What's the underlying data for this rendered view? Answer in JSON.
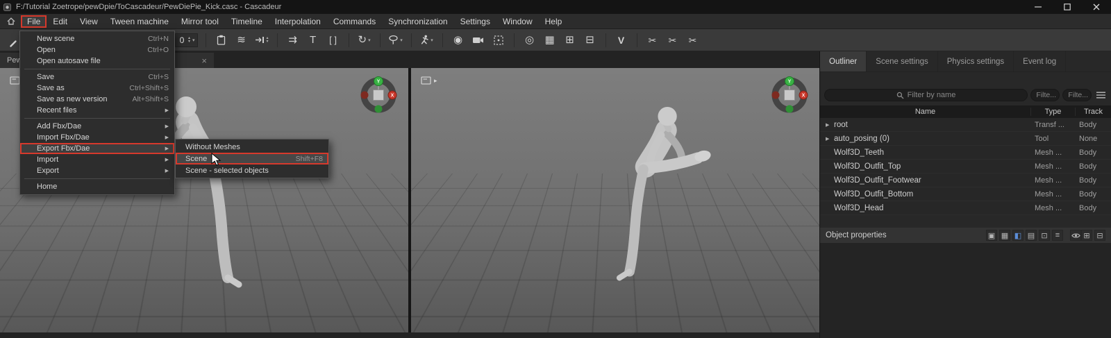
{
  "window": {
    "title": "F:/Tutorial Zoetrope/pewDpie/ToCascadeur/PewDiePie_Kick.casc - Cascadeur"
  },
  "icons": {
    "submenu_arrow": "▶",
    "expander": "▶",
    "vp_arrow": "▸",
    "close": "×",
    "dropdown": "▾",
    "spin_up": "▴",
    "spin_down": "▾",
    "text_tool": "T",
    "brackets": "[ ]",
    "loop": "↻",
    "double_arrows": "⇉",
    "sphere": "◉",
    "rings": "◎",
    "checker": "▦",
    "waves": "≋",
    "win_add_1": "⊞",
    "win_add_2": "⊟",
    "v_tool": "V",
    "scissors": "✂"
  },
  "menubar": {
    "items": [
      {
        "label": "File",
        "boxed": true
      },
      {
        "label": "Edit"
      },
      {
        "label": "View"
      },
      {
        "label": "Tween machine"
      },
      {
        "label": "Mirror tool"
      },
      {
        "label": "Timeline"
      },
      {
        "label": "Interpolation"
      },
      {
        "label": "Commands"
      },
      {
        "label": "Synchronization"
      },
      {
        "label": "Settings"
      },
      {
        "label": "Window"
      },
      {
        "label": "Help"
      }
    ]
  },
  "toolbar": {
    "frame_value": "0"
  },
  "file_menu": {
    "items": [
      {
        "label": "New scene",
        "shortcut": "Ctrl+N"
      },
      {
        "label": "Open",
        "shortcut": "Ctrl+O"
      },
      {
        "label": "Open autosave file"
      },
      {
        "separator": true
      },
      {
        "label": "Save",
        "shortcut": "Ctrl+S"
      },
      {
        "label": "Save as",
        "shortcut": "Ctrl+Shift+S"
      },
      {
        "label": "Save as new version",
        "shortcut": "Alt+Shift+S"
      },
      {
        "label": "Recent files",
        "submenu": true
      },
      {
        "separator": true
      },
      {
        "label": "Add Fbx/Dae",
        "submenu": true
      },
      {
        "label": "Import Fbx/Dae",
        "submenu": true
      },
      {
        "label": "Export Fbx/Dae",
        "submenu": true,
        "highlighted": true
      },
      {
        "label": "Import",
        "submenu": true
      },
      {
        "label": "Export",
        "submenu": true
      },
      {
        "separator": true
      },
      {
        "label": "Home"
      }
    ]
  },
  "export_submenu": {
    "items": [
      {
        "label": "Without Meshes"
      },
      {
        "label": "Scene",
        "shortcut": "Shift+F8",
        "highlighted": true
      },
      {
        "label": "Scene - selected objects"
      }
    ]
  },
  "doc_tab": {
    "label": "Pew"
  },
  "gizmo": {
    "up": "Y",
    "right": "X",
    "up_color": "#3cb54a",
    "right_color": "#c8372a"
  },
  "outliner": {
    "tabs": [
      {
        "label": "Outliner",
        "active": true
      },
      {
        "label": "Scene settings"
      },
      {
        "label": "Physics settings"
      },
      {
        "label": "Event log"
      }
    ],
    "filter_placeholder": "Filter by name",
    "small_filter_placeholder": "Filte...",
    "columns": [
      "Name",
      "Type",
      "Track"
    ],
    "rows": [
      {
        "name": "root",
        "type": "Transf ...",
        "track": "Body",
        "expandable": true
      },
      {
        "name": "auto_posing (0)",
        "type": "Tool",
        "track": "None",
        "expandable": true
      },
      {
        "name": "Wolf3D_Teeth",
        "type": "Mesh ...",
        "track": "Body"
      },
      {
        "name": "Wolf3D_Outfit_Top",
        "type": "Mesh ...",
        "track": "Body"
      },
      {
        "name": "Wolf3D_Outfit_Footwear",
        "type": "Mesh ...",
        "track": "Body"
      },
      {
        "name": "Wolf3D_Outfit_Bottom",
        "type": "Mesh ...",
        "track": "Body"
      },
      {
        "name": "Wolf3D_Head",
        "type": "Mesh ...",
        "track": "Body"
      }
    ]
  },
  "object_properties": {
    "label": "Object properties",
    "icons_left": [
      {
        "glyph": "▣"
      },
      {
        "glyph": "▦"
      },
      {
        "glyph": "◧",
        "blue": true
      },
      {
        "glyph": "▤"
      },
      {
        "glyph": "⊡"
      },
      {
        "glyph": "≡"
      }
    ],
    "icons_right": [
      {
        "glyph": "⊞"
      },
      {
        "glyph": "⊟"
      }
    ]
  }
}
